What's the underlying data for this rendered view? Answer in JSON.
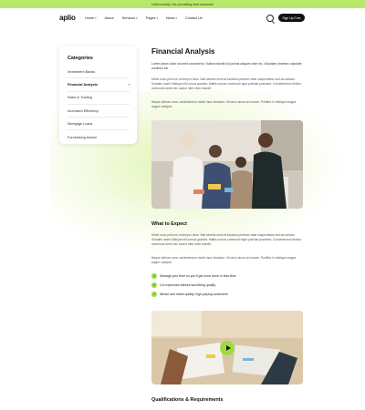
{
  "announcement": "Until recently, the prevailing view assumed",
  "header": {
    "logo": "aplio",
    "nav": [
      {
        "label": "Home",
        "has_dropdown": true
      },
      {
        "label": "About",
        "has_dropdown": false
      },
      {
        "label": "Services",
        "has_dropdown": true
      },
      {
        "label": "Pages",
        "has_dropdown": true
      },
      {
        "label": "News",
        "has_dropdown": true
      },
      {
        "label": "Contact Us",
        "has_dropdown": false
      }
    ],
    "search_icon": "search-icon",
    "signup_label": "Sign Up Free"
  },
  "sidebar": {
    "title": "Categories",
    "items": [
      {
        "label": "Investment Banks",
        "active": false
      },
      {
        "label": "Financial Analysis",
        "active": true
      },
      {
        "label": "Sales & Trading",
        "active": false
      },
      {
        "label": "Increased Efficiency",
        "active": false
      },
      {
        "label": "Mortgage Loans",
        "active": false
      },
      {
        "label": "Fundraising Advice",
        "active": false
      }
    ]
  },
  "main": {
    "title": "Financial Analysis",
    "intro": "Lorem ipsum dolor sit amet consectetur. Nullam blandit dui proinia aliquam ante leo. Vulputate pharetra vulputate curabitur elit.",
    "para1": "Morbi nunc proin mi ut tempor risus. Nisl lobortis enim at faucibus pretium vitae suspendisse sed accumsan. Sodales morbi tristique elit cursus gravida. Mattis cursus commodo eget pulvinar praesent. Condimentum finibus commodo amet nec auctor nibh enim blandit.",
    "para2": "Neque ultrices nunc condimentum morbi risus tincidunt. Vel arcu lacus vel ornare. Porttitor in tristique magna augue volutpat.",
    "expect_title": "What to Expect",
    "expect_para1": "Morbi nunc proin mi ut tempor risus. Nisl lobortis enim at faucibus pretium vitae suspendisse sed accumsan. Sodales morbi tristique elit cursus gravida. Mattis cursus commodo eget pulvinar praesent. Condimentum finibus commodo amet nec auctor nibh enim blandit.",
    "expect_para2": "Neque ultrices nunc condimentum morbi risus tincidunt. Vel arcu lacus vel ornare. Porttitor in tristique magna augue volutpat.",
    "bullets": [
      "Manage your time so you'll get more done in less time",
      "Cut expenses without sacrificing quality",
      "Attract and retain quality, high-paying customers"
    ],
    "qual_title": "Qualifications & Requirements"
  },
  "colors": {
    "accent": "#9edc3e",
    "topbar": "#b8e86a",
    "dark": "#111111"
  }
}
